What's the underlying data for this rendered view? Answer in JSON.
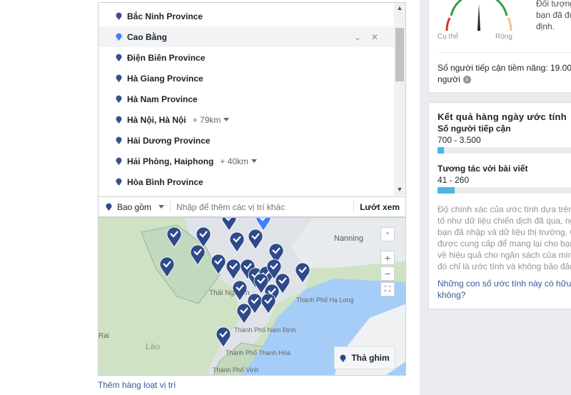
{
  "locations": {
    "items": [
      {
        "name": "Bắc Ninh Province",
        "pin_color": "#3b4f8f"
      },
      {
        "name": "Cao Bằng",
        "pin_color": "#4080ff",
        "highlighted": true
      },
      {
        "name": "Điện Biên Province",
        "pin_color": "#3b4f8f"
      },
      {
        "name": "Hà Giang Province",
        "pin_color": "#3b4f8f"
      },
      {
        "name": "Hà Nam Province",
        "pin_color": "#3b4f8f"
      },
      {
        "name": "Hà Nội, Hà Nội",
        "radius": "+ 79km",
        "pin_color": "#3b4f8f"
      },
      {
        "name": "Hải Dương Province",
        "pin_color": "#3b4f8f"
      },
      {
        "name": "Hải Phòng, Haiphong",
        "radius": "+ 40km",
        "pin_color": "#3b4f8f"
      },
      {
        "name": "Hòa Bình Province",
        "pin_color": "#3b4f8f"
      }
    ],
    "include_label": "Bao gồm",
    "input_placeholder": "Nhập để thêm các vị trí khác",
    "browse_label": "Lướt xem",
    "bulk_add_link": "Thêm hàng loạt vị trí"
  },
  "map": {
    "labels": {
      "nanning": "Nanning",
      "thai_nguyen": "Thái Nguyên",
      "ha_long": "Thành Phố Hạ Long",
      "nam_dinh": "Thành Phố Nam Định",
      "thanh_hoa": "Thành Phố Thanh Hóa",
      "vinh": "Thành Phố Vinh",
      "lao": "Lào",
      "rai": "Rai"
    },
    "zoom_in": "+",
    "zoom_out": "−",
    "drop_pin_label": "Thả ghim",
    "colors": {
      "land": "#cfe3c4",
      "region": "#dfe3e8",
      "sea": "#a6cdf7",
      "pin": "#2e4a8a",
      "pin_selected": "#4080ff"
    }
  },
  "audience": {
    "description": "Đối tượng bạn đã được xác định.",
    "desc_lines": [
      "Đối tượng",
      "bạn đã đư",
      "định."
    ],
    "gauge_left": "Cụ thể",
    "gauge_right": "Rộng",
    "potential_reach": "Số người tiếp cận tiềm năng: 19.000",
    "potential_reach_unit": "người"
  },
  "estimates": {
    "title": "Kết quả hàng ngày ước tính",
    "reach_label": "Số người tiếp cận",
    "reach_value": "700 - 3.500",
    "reach_fill_pct": 5,
    "engagement_label": "Tương tác với bài viết",
    "engagement_value": "41 - 260",
    "engagement_fill_pct": 13,
    "disclaimer": [
      "Độ chính xác của ước tính dựa trên c",
      "tố như dữ liệu chiến dịch đã qua, ng",
      "bạn đã nhập và dữ liệu thị trường. C",
      "được cung cấp để mang lại cho bạn",
      "về hiệu quả cho ngân sách của mình",
      "đó chỉ là ước tính và không bảo đảm"
    ],
    "helpful_question": [
      "Những con số ước tính này có hữu í",
      "không?"
    ]
  }
}
